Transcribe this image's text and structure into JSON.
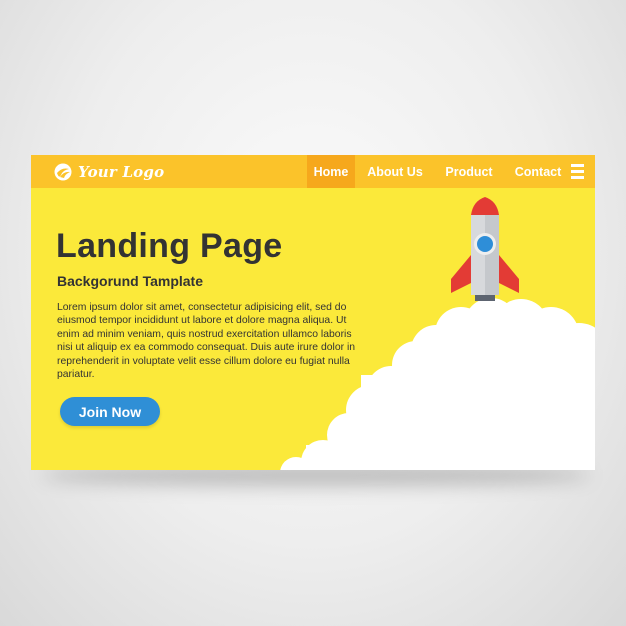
{
  "brand": {
    "logo_text": "Your Logo",
    "logo_icon": "swirl-logo-icon"
  },
  "nav": {
    "items": [
      {
        "label": "Home",
        "active": true
      },
      {
        "label": "About Us",
        "active": false
      },
      {
        "label": "Product",
        "active": false
      },
      {
        "label": "Contact",
        "active": false
      }
    ],
    "menu_icon": "hamburger-menu-icon"
  },
  "hero": {
    "title": "Landing Page",
    "subtitle": "Backgorund Tamplate",
    "body": "Lorem ipsum dolor sit amet, consectetur adipisicing elit, sed do eiusmod tempor incididunt ut labore et dolore magna aliqua. Ut enim ad minim veniam, quis nostrud exercitation ullamco laboris nisi ut aliquip ex ea commodo consequat. Duis aute irure dolor in reprehenderit in voluptate velit esse cillum dolore eu fugiat nulla pariatur.",
    "cta_label": "Join Now",
    "illustration": "rocket-launch-illustration"
  },
  "colors": {
    "page_background": "#eeeeee",
    "hero_yellow": "#fbe93a",
    "topbar_orange": "#fbc32a",
    "active_nav_orange": "#f6a81c",
    "text_dark": "#333333",
    "button_blue": "#2f8fd6",
    "rocket_red": "#e33b35",
    "rocket_body": "#d7d9dc",
    "window_blue": "#2e8ed8",
    "cloud_white": "#ffffff"
  }
}
